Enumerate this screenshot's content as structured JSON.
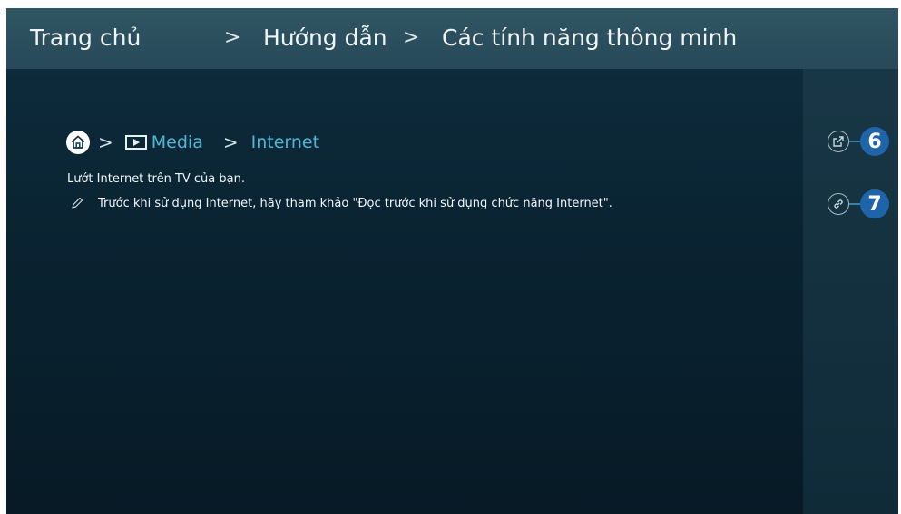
{
  "breadcrumb": {
    "items": [
      "Trang chủ",
      "Hướng dẫn",
      "Các tính năng thông minh"
    ],
    "separator": ">"
  },
  "path": {
    "home_icon": "home-icon",
    "separator": ">",
    "media_label": "Media",
    "internet_label": "Internet"
  },
  "content": {
    "description": "Lướt Internet trên TV của bạn.",
    "note": "Trước khi sử dụng Internet, hãy tham khảo \"Đọc trước khi sử dụng chức năng Internet\"."
  },
  "actions": [
    {
      "icon": "open-external-icon",
      "badge": "6"
    },
    {
      "icon": "link-icon",
      "badge": "7"
    }
  ],
  "colors": {
    "link": "#4fb8d8",
    "badge": "#1f63a8"
  }
}
